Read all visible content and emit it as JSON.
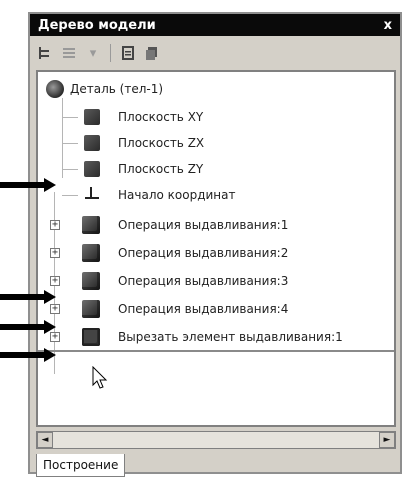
{
  "window": {
    "title": "Дерево модели",
    "close": "x"
  },
  "toolbar": {
    "icons": [
      "tree-view-icon",
      "dropdown-view-icon",
      "dropdown-chevron-icon",
      "document-icon",
      "copy-icon"
    ]
  },
  "tree": {
    "items": [
      {
        "label": "Деталь (тел-1)",
        "icon": "part-icon",
        "type": "root"
      },
      {
        "label": "Плоскость XY",
        "icon": "plane-icon",
        "type": "child"
      },
      {
        "label": "Плоскость ZX",
        "icon": "plane-icon",
        "type": "child"
      },
      {
        "label": "Плоскость ZY",
        "icon": "plane-icon",
        "type": "child"
      },
      {
        "label": "Начало координат",
        "icon": "origin-icon",
        "type": "child"
      },
      {
        "label": "Операция выдавливания:1",
        "icon": "extrude-icon",
        "type": "expandable"
      },
      {
        "label": "Операция выдавливания:2",
        "icon": "extrude-icon",
        "type": "expandable"
      },
      {
        "label": "Операция выдавливания:3",
        "icon": "extrude-icon",
        "type": "expandable"
      },
      {
        "label": "Операция выдавливания:4",
        "icon": "extrude-icon",
        "type": "expandable"
      },
      {
        "label": "Вырезать элемент выдавливания:1",
        "icon": "cut-extrude-icon",
        "type": "expandable"
      }
    ],
    "expander_symbol": "+"
  },
  "scrollbar": {
    "left": "◄",
    "right": "►"
  },
  "tabs": {
    "active": "Построение"
  },
  "annotations": {
    "arrows_point_to": [
      "Плоскость ZY",
      "Операция выдавливания:3",
      "Операция выдавливания:4",
      "Вырезать элемент выдавливания:1"
    ]
  }
}
